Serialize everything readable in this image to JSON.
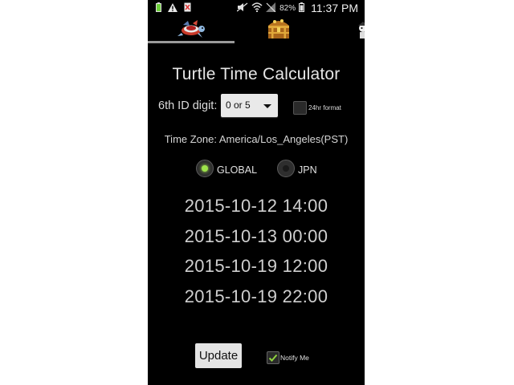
{
  "status_bar": {
    "time": "11:37 PM",
    "battery_percent": "82%",
    "left_icons": [
      "battery-saver-icon",
      "warning-icon",
      "no-sim-icon"
    ],
    "right_icons": [
      "mute-icon",
      "wifi-icon",
      "signal-icon",
      "battery-icon"
    ]
  },
  "tabs": [
    {
      "icon": "turtle-icon",
      "selected": true
    },
    {
      "icon": "treasure-chest-icon",
      "selected": false
    },
    {
      "icon": "pirate-icon",
      "selected": false
    }
  ],
  "app": {
    "title": "Turtle Time Calculator",
    "id_digit_label": "6th ID digit:",
    "id_digit_value": "0 or 5",
    "format_label": "24hr format",
    "format_checked": false,
    "timezone": "Time Zone: America/Los_Angeles(PST)",
    "radios": {
      "global_label": "GLOBAL",
      "jpn_label": "JPN",
      "selected": "GLOBAL"
    },
    "times": [
      "2015-10-12 14:00",
      "2015-10-13 00:00",
      "2015-10-19 12:00",
      "2015-10-19 22:00"
    ],
    "update_label": "Update",
    "notify_label": "Notify Me",
    "notify_checked": true
  },
  "colors": {
    "background": "#000000",
    "radio_selected": "#9ee34b",
    "checkmark": "#8fd13f"
  }
}
